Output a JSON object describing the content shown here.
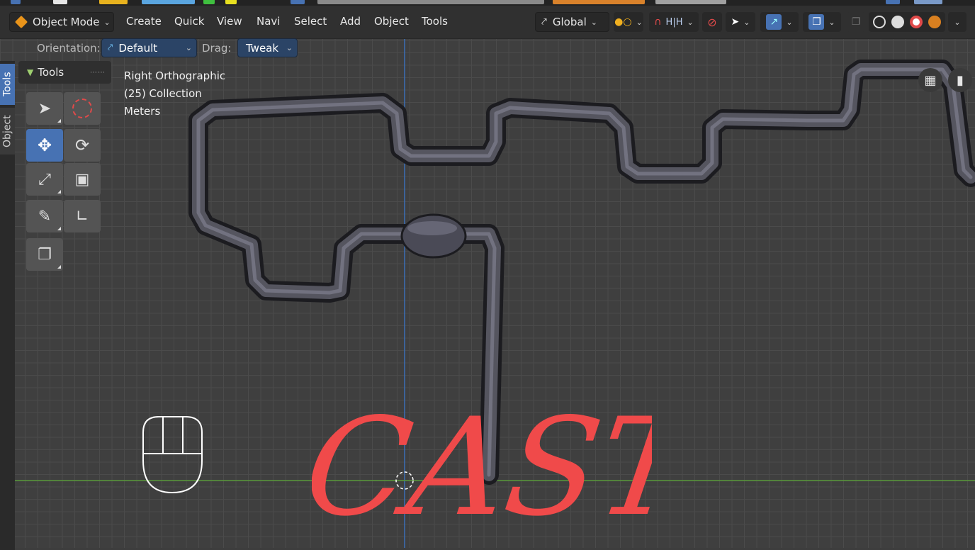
{
  "header": {
    "mode": "Object Mode",
    "menus": [
      "Create",
      "Quick",
      "View",
      "Navi",
      "Select",
      "Add",
      "Object",
      "Tools"
    ],
    "transform_orientation": "Global"
  },
  "subheader": {
    "orientation_label": "Orientation:",
    "orientation_value": "Default",
    "drag_label": "Drag:",
    "drag_value": "Tweak"
  },
  "side_tabs": [
    "Tools",
    "Object"
  ],
  "tools_panel": {
    "title": "Tools",
    "tools": [
      "select-box",
      "cursor",
      "move",
      "rotate",
      "scale",
      "transform",
      "annotate",
      "measure",
      "add-cube"
    ],
    "active_tool": "move"
  },
  "viewport": {
    "view_name": "Right Orthographic",
    "collection": "(25) Collection",
    "units": "Meters"
  },
  "overlay": {
    "logo_text": "CAST"
  },
  "colors": {
    "active_blue": "#4772b3",
    "logo_red": "#f04a4a",
    "axis_green": "#5a9a3a",
    "axis_blue": "#3b6fb5"
  }
}
